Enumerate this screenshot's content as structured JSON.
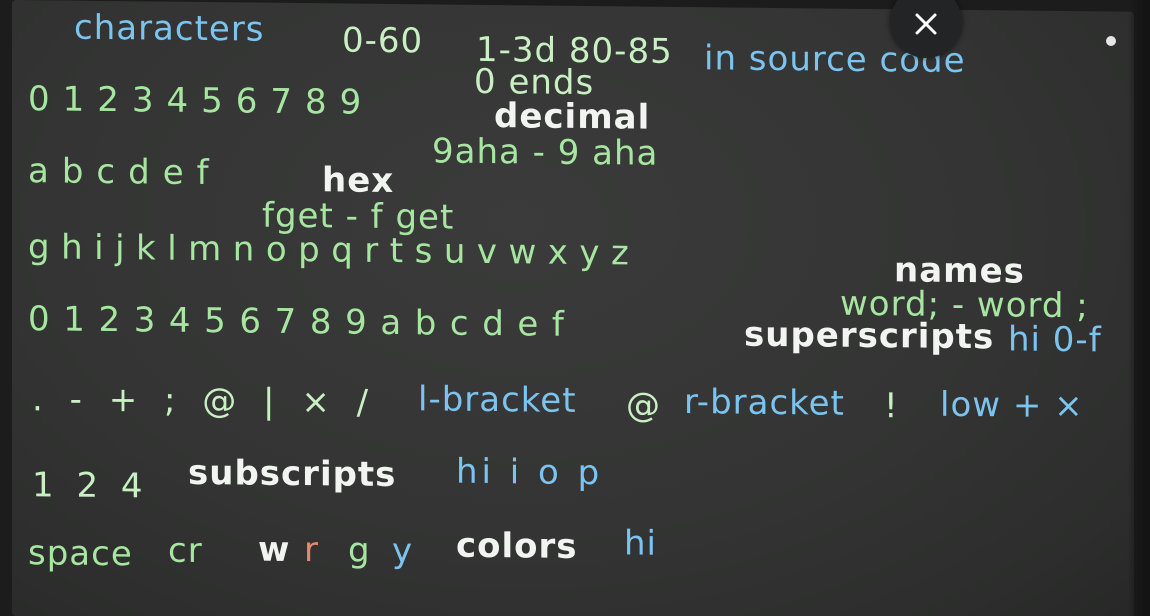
{
  "line1": {
    "characters": "characters",
    "range_a": "0-60",
    "range_b": "1-3d 80-85",
    "in_source": "in source code",
    "ends": "0 ends"
  },
  "line2": {
    "digits": "0123456789",
    "label": "decimal",
    "example": "9aha - 9 aha"
  },
  "line3": {
    "letters": "abcdef",
    "label": "hex",
    "example": "fget - f get"
  },
  "line4": {
    "letters": "ghijklmnopqrtsuvwxyz",
    "label": "names",
    "example": "word; - word ;"
  },
  "line5": {
    "chars": "0123456789abcdef",
    "label": "superscripts",
    "suffix": "hi 0-f"
  },
  "line6": {
    "punct": ". - + ; @ | × /",
    "lbracket": "l-bracket",
    "lbracket_sym": "@",
    "rbracket": "r-bracket",
    "rbracket_sym": "!",
    "low": "low + ×"
  },
  "line7": {
    "digits": "1 2 4",
    "label": "subscripts",
    "suffix": "hi i o p"
  },
  "line8": {
    "space": "space",
    "cr": "cr",
    "color_w": "w",
    "color_r": "r",
    "color_g": "g",
    "color_y": "y",
    "label": "colors",
    "suffix": "hi"
  },
  "colors": {
    "green": "#a6e6a0",
    "white": "#f2f4f2",
    "blue": "#7cc4f0",
    "red": "#e88a6a",
    "background": "#333433"
  },
  "icons": {
    "close": "close-icon"
  }
}
